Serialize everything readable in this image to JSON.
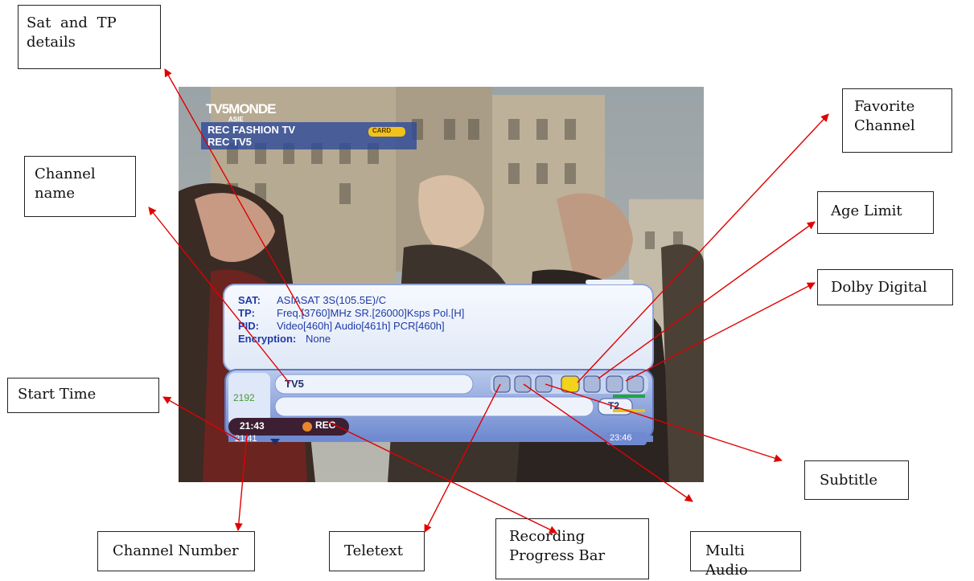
{
  "colors": {
    "arrow": "#e00000",
    "osd_text": "#1f3aa6",
    "osd_panel": "#eef3fb",
    "favorite": "#f2d21a"
  },
  "tv_screen": {
    "broadcaster_logo": "TV5MONDE",
    "logo_sub": "ASIE",
    "rec_list": [
      {
        "label": "REC  FASHION TV",
        "badge": "CARD"
      },
      {
        "label": "REC  TV5"
      }
    ],
    "info_panel": {
      "sat_label": "SAT:",
      "sat_value": "ASIASAT 3S(105.5E)/C",
      "tp_label": "TP:",
      "tp_value": "Freq.[3760]MHz SR.[26000]Ksps Pol.[H]",
      "pid_label": "PID:",
      "pid_value": "Video[460h] Audio[461h] PCR[460h]",
      "enc_label": "Encryption:",
      "enc_value": "None"
    },
    "channel_bar": {
      "channel_number": "2192",
      "channel_name": "TV5",
      "current_time": "21:43",
      "rec_label": "REC",
      "start_time": "21:41",
      "end_time": "23:46",
      "tuner": "T2",
      "icons": [
        "teletext-icon",
        "multi-audio-icon",
        "subtitle-icon",
        "favorite-icon",
        "age-limit-icon",
        "dolby-icon",
        "info-icon"
      ]
    }
  },
  "callouts": {
    "sat_tp": [
      "Sat   and   TP",
      "details"
    ],
    "channel_name": [
      "Channel",
      "name"
    ],
    "start_time": "Start Time",
    "channel_number": "Channel Number",
    "teletext": "Teletext",
    "recording_progress": [
      "Recording",
      "Progress Bar"
    ],
    "multi_audio": "Multi Audio",
    "subtitle": "Subtitle",
    "dolby": "Dolby Digital",
    "age_limit": "Age Limit",
    "favorite": [
      "Favorite",
      "Channel"
    ]
  }
}
